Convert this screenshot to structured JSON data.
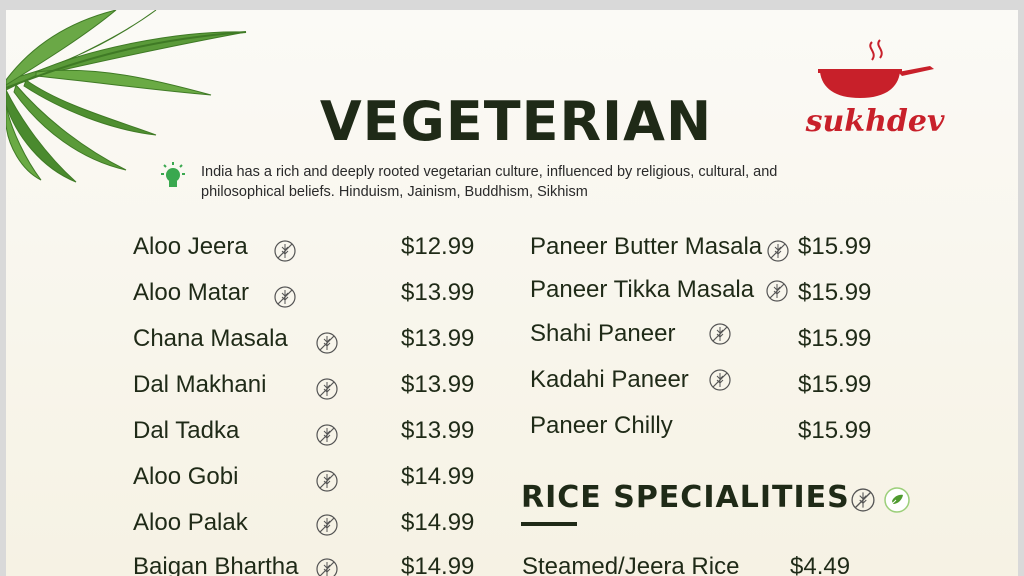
{
  "menu": {
    "title": "VEGETERIAN",
    "intro": "India has a rich and deeply rooted vegetarian culture, influenced by religious, cultural, and philosophical beliefs. Hinduism, Jainism, Buddhism, Sikhism",
    "left_items": [
      {
        "name": "Aloo Jeera",
        "price": "$12.99"
      },
      {
        "name": "Aloo Matar",
        "price": "$13.99"
      },
      {
        "name": "Chana Masala",
        "price": "$13.99"
      },
      {
        "name": "Dal Makhani",
        "price": "$13.99"
      },
      {
        "name": "Dal Tadka",
        "price": "$13.99"
      },
      {
        "name": "Aloo Gobi",
        "price": "$14.99"
      },
      {
        "name": "Aloo Palak",
        "price": "$14.99"
      },
      {
        "name": "Baigan Bhartha",
        "price": "$14.99"
      }
    ],
    "right_items": [
      {
        "name": "Paneer Butter Masala",
        "price": "$15.99"
      },
      {
        "name": "Paneer Tikka Masala",
        "price": "$15.99"
      },
      {
        "name": "Shahi Paneer",
        "price": "$15.99"
      },
      {
        "name": "Kadahi Paneer",
        "price": "$15.99"
      },
      {
        "name": "Paneer Chilly",
        "price": "$15.99"
      }
    ],
    "rice_section": {
      "title": "RICE  SPECIALITIES",
      "items": [
        {
          "name": "Steamed/Jeera Rice",
          "price": "$4.49"
        }
      ]
    }
  },
  "brand": {
    "name": "sukhdev",
    "color": "#c8202a"
  },
  "icons": {
    "gluten_free": "no-wheat-icon",
    "vegetarian": "leaf-check-icon",
    "info": "lightbulb-icon",
    "decor": "leaves-icon",
    "logo": "wok-icon"
  },
  "colors": {
    "text": "#1f2a17",
    "accent": "#c8202a",
    "leaf_green": "#4f9a2f",
    "background": "#f8f5ea"
  }
}
